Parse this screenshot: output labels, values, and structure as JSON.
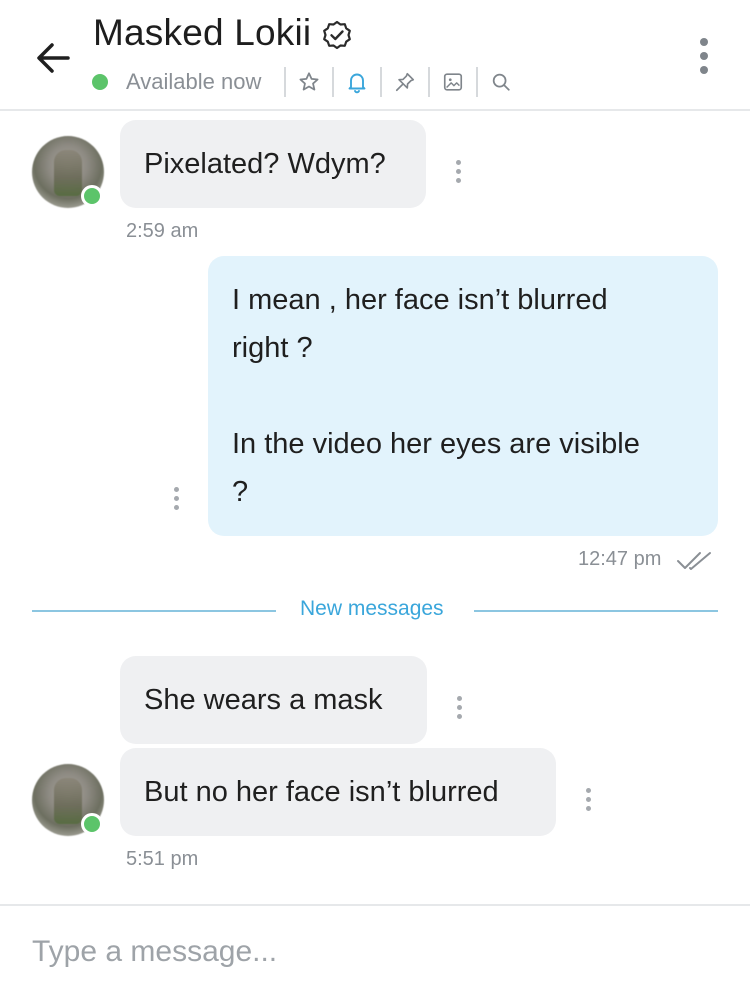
{
  "header": {
    "title": "Masked Lokii",
    "status": "Available now",
    "icons": [
      "star-icon",
      "bell-icon",
      "pin-icon",
      "image-icon",
      "search-icon"
    ]
  },
  "messages": [
    {
      "direction": "in",
      "text": "Pixelated? Wdym?",
      "time": "2:59 am"
    },
    {
      "direction": "out",
      "lines": [
        "I mean , her face isn’t blurred",
        "right ?",
        "",
        "In the video her eyes are visible",
        "?"
      ],
      "time": "12:47 pm",
      "read_receipt": "double-check-icon"
    },
    {
      "direction": "in",
      "text": "She wears a mask"
    },
    {
      "direction": "in",
      "text": "But no her face isn’t blurred",
      "time": "5:51 pm"
    }
  ],
  "divider": {
    "label": "New messages"
  },
  "composer": {
    "placeholder": "Type a message..."
  },
  "colors": {
    "accent": "#3aa6db",
    "online": "#5cc46a",
    "incoming_bubble": "#eff0f2",
    "outgoing_bubble": "#e2f3fc"
  }
}
